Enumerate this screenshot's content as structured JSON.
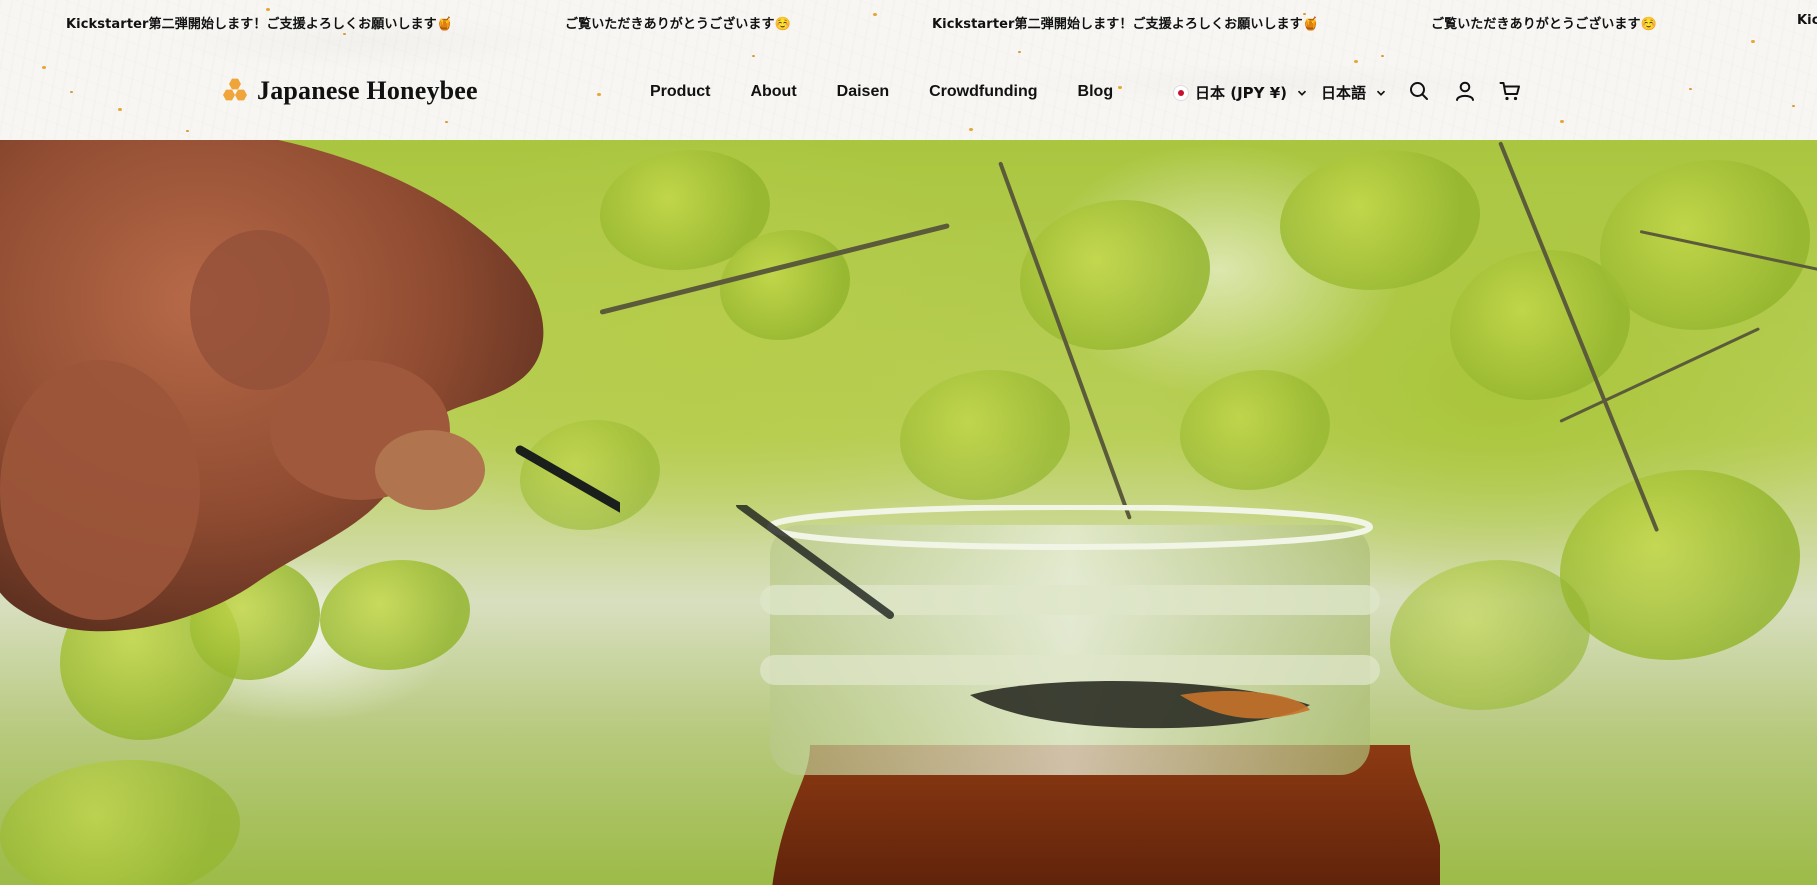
{
  "announcement": {
    "items": [
      "Kickstarter第二弾開始します！ご支援よろしくお願いします🍯",
      "ご覧いただきありがとうございます☺️",
      "Kickstarter第二弾開始します！ご支援よろしくお願いします🍯",
      "ご覧いただきありがとうございます☺️",
      "Kick"
    ]
  },
  "header": {
    "logo_text": "Japanese Honeybee",
    "nav": [
      "Product",
      "About",
      "Daisen",
      "Crowdfunding",
      "Blog"
    ],
    "currency_label": "日本 (JPY ¥)",
    "language_label": "日本語",
    "icons": [
      "search-icon",
      "account-icon",
      "cart-icon"
    ]
  },
  "hero": {
    "image": "hand-spooning-honey-from-glass-jar"
  },
  "colors": {
    "accent": "#f0a53a",
    "text": "#111111",
    "flag_red": "#c9102a"
  }
}
